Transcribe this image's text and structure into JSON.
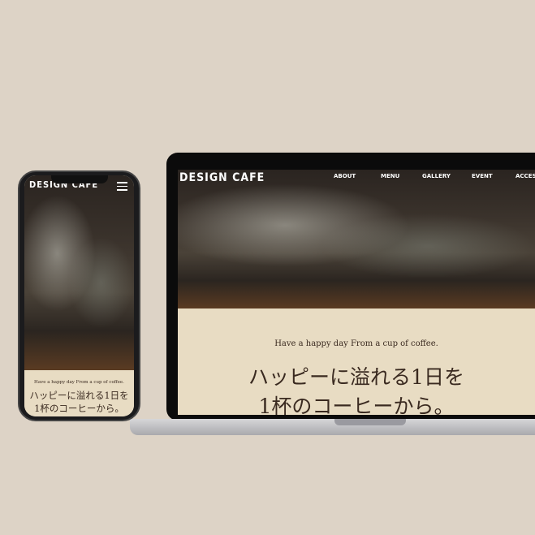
{
  "site": {
    "logo": "DESIGN CAFE",
    "tagline": "Have a happy day From a cup of coffee.",
    "headline_line1": "ハッピーに溢れる1日を",
    "headline_line2": "1杯のコーヒーから。"
  },
  "nav": [
    {
      "label": "ABOUT"
    },
    {
      "label": "MENU"
    },
    {
      "label": "GALLERY"
    },
    {
      "label": "EVENT"
    },
    {
      "label": "ACCESS"
    }
  ],
  "colors": {
    "background": "#ddd3c6",
    "cream": "#e8dcc3",
    "text": "#3a2a20"
  },
  "icons": {
    "menu": "hamburger-icon"
  }
}
